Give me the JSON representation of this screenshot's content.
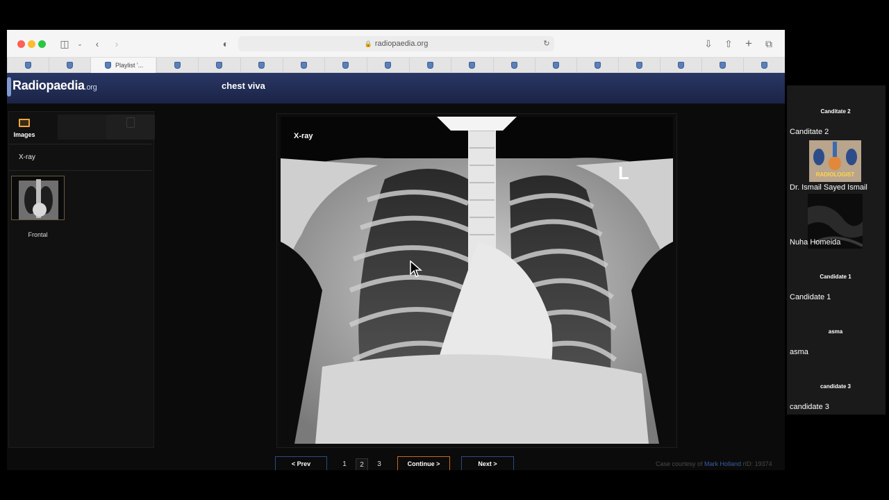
{
  "browser": {
    "url": "radiopaedia.org",
    "active_tab_title": "Playlist '...",
    "tab_count": 18
  },
  "site": {
    "logo_main": "Radiopaedia",
    "logo_suffix": ".org",
    "playlist_title": "chest viva"
  },
  "sidebar": {
    "tab_images_label": "Images",
    "section_title": "X-ray",
    "thumbnail_label": "Frontal"
  },
  "viewer": {
    "modality_label": "X-ray",
    "side_marker": "L"
  },
  "pagination": {
    "prev_label": "<  Prev",
    "pages": [
      "1",
      "2",
      "3"
    ],
    "current_page": "2",
    "continue_label": "Continue  >",
    "next_label": "Next  >"
  },
  "footer": {
    "courtesy_prefix": "Case courtesy of",
    "author": "Mark Holland",
    "rid": "rID: 19374"
  },
  "participants": [
    {
      "tile_label": "Canditate 2",
      "name": "Canditate 2"
    },
    {
      "tile_label": "",
      "name": "Dr. Ismail Sayed Ismail",
      "image_text": "RADIOLOGIST"
    },
    {
      "tile_label": "",
      "name": "Nuha Homeida"
    },
    {
      "tile_label": "Candidate 1",
      "name": "Candidate 1"
    },
    {
      "tile_label": "asma",
      "name": "asma"
    },
    {
      "tile_label": "candidate 3",
      "name": "candidate 3"
    }
  ],
  "colors": {
    "header_bg": "#1f2a52",
    "continue_border": "#c86a1a",
    "nav_border": "#2e4a86"
  }
}
